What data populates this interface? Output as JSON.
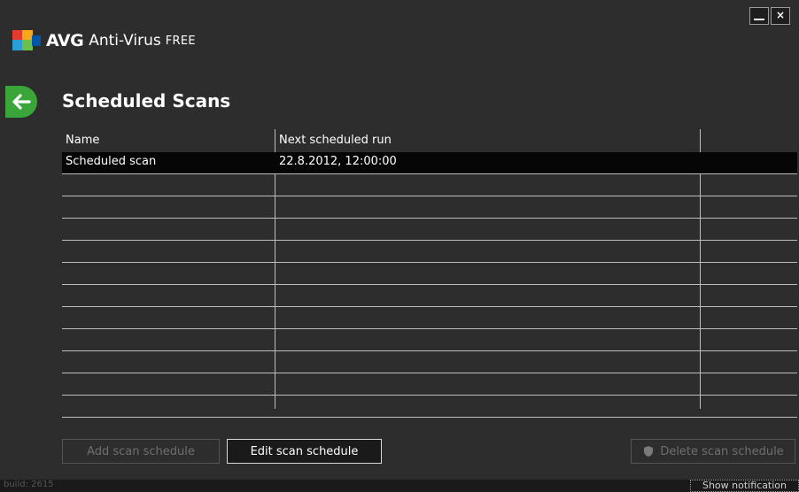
{
  "window": {
    "minimize_label": "",
    "close_label": "×"
  },
  "logo": {
    "brand": "AVG",
    "product": "Anti-Virus",
    "edition": "FREE"
  },
  "page": {
    "title": "Scheduled Scans"
  },
  "table": {
    "columns": [
      "Name",
      "Next scheduled run"
    ],
    "rows": [
      {
        "name": "Scheduled scan",
        "next_run": "22.8.2012, 12:00:00"
      }
    ]
  },
  "buttons": {
    "add": "Add scan schedule",
    "edit": "Edit scan schedule",
    "delete": "Delete scan schedule"
  },
  "footer": {
    "build": "build: 2615",
    "notification": "Show notification"
  },
  "colors": {
    "background": "#2d2d2d",
    "back_button": "#3aa63a",
    "selected_row": "#060606"
  }
}
